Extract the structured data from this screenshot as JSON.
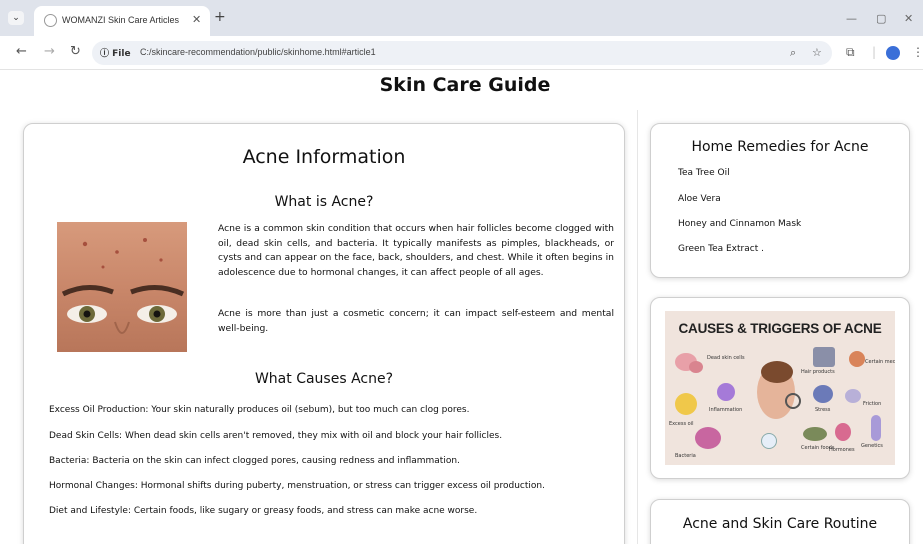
{
  "browser": {
    "tab_title": "WOMANZI Skin Care Articles",
    "file_label": "File",
    "url": "C:/skincare-recommendation/public/skinhome.html#article1"
  },
  "page": {
    "title": "Skin Care Guide"
  },
  "article": {
    "heading": "Acne Information",
    "what_heading": "What is Acne?",
    "paragraph1": "Acne is a common skin condition that occurs when hair follicles become clogged with oil, dead skin cells, and bacteria. It typically manifests as pimples, blackheads, or cysts and can appear on the face, back, shoulders, and chest. While it often begins in adolescence due to hormonal changes, it can affect people of all ages.",
    "paragraph2": "Acne is more than just a cosmetic concern; it can impact self-esteem and mental well-being.",
    "causes_heading": "What Causes Acne?",
    "causes": [
      "Excess Oil Production: Your skin naturally produces oil (sebum), but too much can clog pores.",
      "Dead Skin Cells: When dead skin cells aren't removed, they mix with oil and block your hair follicles.",
      "Bacteria: Bacteria on the skin can infect clogged pores, causing redness and inflammation.",
      "Hormonal Changes: Hormonal shifts during puberty, menstruation, or stress can trigger excess oil production.",
      "Diet and Lifestyle: Certain foods, like sugary or greasy foods, and stress can make acne worse."
    ]
  },
  "remedies": {
    "title": "Home Remedies for Acne",
    "items": [
      "Tea Tree Oil",
      "Aloe Vera",
      "Honey and Cinnamon Mask",
      "Green Tea Extract ."
    ]
  },
  "poster": {
    "title": "CAUSES & TRIGGERS OF ACNE",
    "labels": {
      "dead_skin": "Dead skin cells",
      "hair_products": "Hair products",
      "certain_medications": "Certain medications",
      "inflammation": "Inflammation",
      "stress": "Stress",
      "friction": "Friction",
      "excess_oil": "Excess oil",
      "bacteria": "Bacteria",
      "certain_foods": "Certain foods",
      "hormones": "Hormones",
      "genetics": "Genetics"
    }
  },
  "routine": {
    "title": "Acne and Skin Care Routine"
  },
  "colors": {
    "tabstrip": "#dfe3eb",
    "omnibox": "#eef1f6",
    "poster_bg": "#f0e4dd",
    "avatar": "#3a6fd8"
  }
}
